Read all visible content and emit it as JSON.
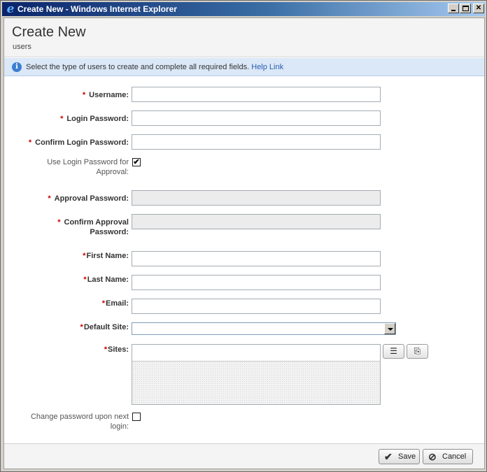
{
  "window": {
    "title": "Create New - Windows Internet Explorer",
    "app_icon": "ie-logo-icon",
    "app_icon_glyph": "e"
  },
  "header": {
    "title": "Create New",
    "subtitle": "users"
  },
  "info": {
    "icon": "info-icon",
    "icon_glyph": "i",
    "message": "Select the type of users to create and complete all required fields.",
    "link_text": "Help Link"
  },
  "form": {
    "required_marker": "*",
    "username": {
      "label": "Username:",
      "value": ""
    },
    "login_password": {
      "label": "Login Password:",
      "value": ""
    },
    "confirm_login_password": {
      "label": "Confirm Login Password:",
      "value": ""
    },
    "use_login_for_approval": {
      "label": "Use Login Password for Approval:",
      "checked": true,
      "glyph": "✔"
    },
    "approval_password": {
      "label": "Approval Password:",
      "value": "",
      "disabled": true
    },
    "confirm_approval_password": {
      "label": "Confirm Approval Password:",
      "value": "",
      "disabled": true
    },
    "first_name": {
      "label": "First Name:",
      "value": ""
    },
    "last_name": {
      "label": "Last Name:",
      "value": ""
    },
    "email": {
      "label": "Email:",
      "value": ""
    },
    "default_site": {
      "label": "Default Site:",
      "selected": ""
    },
    "sites": {
      "label": "Sites:",
      "list_icon": "list-icon",
      "list_glyph": "☰",
      "add_icon": "add-page-icon",
      "add_glyph": "⎘"
    },
    "change_password_next_login": {
      "label": "Change password upon next login:",
      "checked": false
    }
  },
  "footer": {
    "save_label": "Save",
    "save_icon": "checkmark-icon",
    "save_glyph": "✔",
    "cancel_label": "Cancel",
    "cancel_icon": "cancel-circle-icon",
    "cancel_glyph": "⊘"
  },
  "colors": {
    "required": "#cc0000",
    "info_bar": "#dbe8f7",
    "link": "#2a5db0",
    "title_bar_start": "#0a246a"
  }
}
